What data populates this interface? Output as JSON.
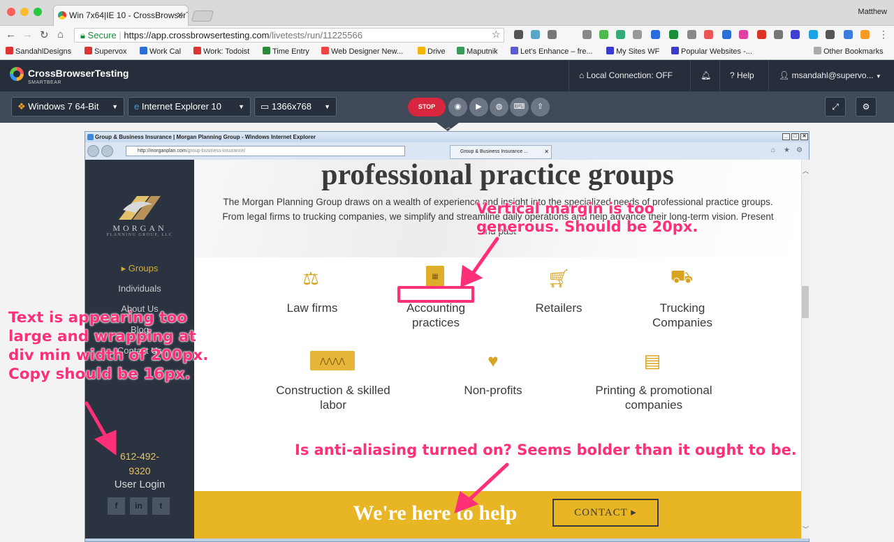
{
  "browser": {
    "tab_title": "Win 7x64|IE 10 - CrossBrowserTe",
    "user": "Matthew",
    "secure_label": "Secure",
    "url_host": "https://app.crossbrowsertesting.com",
    "url_path": "/livetests/run/11225566",
    "bookmarks": [
      "SandahlDesigns",
      "Supervox",
      "Work Cal",
      "Work: Todoist",
      "Time Entry",
      "Web Designer New...",
      "Drive",
      "Maputnik",
      "Let's Enhance – fre...",
      "My Sites WF",
      "Popular Websites -...",
      "Other Bookmarks"
    ]
  },
  "cbt": {
    "brand": "CrossBrowserTesting",
    "brand_sub": "SMARTBEAR",
    "local_connection": "Local Connection: OFF",
    "help": "Help",
    "account": "msandahl@supervo...",
    "os_select": "Windows 7 64-Bit",
    "browser_select": "Internet Explorer 10",
    "resolution_select": "1366x768",
    "stop_label": "STOP"
  },
  "ie": {
    "window_title": "Group & Business Insurance | Morgan Planning Group - Windows Internet Explorer",
    "address_host": "http://morganplan.com",
    "address_path": "/group-business-insurance/",
    "tab_title": "Group & Business Insurance ..."
  },
  "site": {
    "logo_word": "MORGAN",
    "logo_tag": "PLANNING GROUP, LLC",
    "nav": [
      "▸ Groups",
      "Individuals",
      "About Us",
      "Blog",
      "Contact Us"
    ],
    "phone_line1": "612-492-",
    "phone_line2": "9320",
    "login": "User Login",
    "social": [
      "f",
      "in",
      "t"
    ],
    "heading": "professional practice groups",
    "intro": "The Morgan Planning Group draws on a wealth of experience and insight into the specialized needs of professional practice groups. From legal firms to trucking companies, we simplify and streamline daily operations and help advance their long-term vision. Present and past",
    "groups": [
      {
        "label": "Law firms",
        "icon": "scales-icon"
      },
      {
        "label": "Accounting practices",
        "icon": "calculator-icon"
      },
      {
        "label": "Retailers",
        "icon": "cart-icon"
      },
      {
        "label": "Trucking Companies",
        "icon": "truck-icon"
      },
      {
        "label": "Construction & skilled labor",
        "icon": "saw-icon"
      },
      {
        "label": "Non-profits",
        "icon": "heart-hands-icon"
      },
      {
        "label": "Printing & promotional companies",
        "icon": "paper-stack-icon"
      }
    ],
    "help_text": "We're here to help",
    "contact_label": "CONTACT ▸"
  },
  "annotations": {
    "margin_note": "Vertical margin is too generous. Should be 20px.",
    "text_note": "Text is appearing too large and wrapping at div min width of 200px. Copy should be 16px.",
    "aa_note": "Is anti-aliasing turned on? Seems bolder than it ought to be."
  },
  "colors": {
    "annotation": "#ff2f78",
    "accent_gold": "#e8b625",
    "sidebar": "#2c3340",
    "cbt_header": "#252e3a",
    "stop_red": "#d7263d"
  }
}
